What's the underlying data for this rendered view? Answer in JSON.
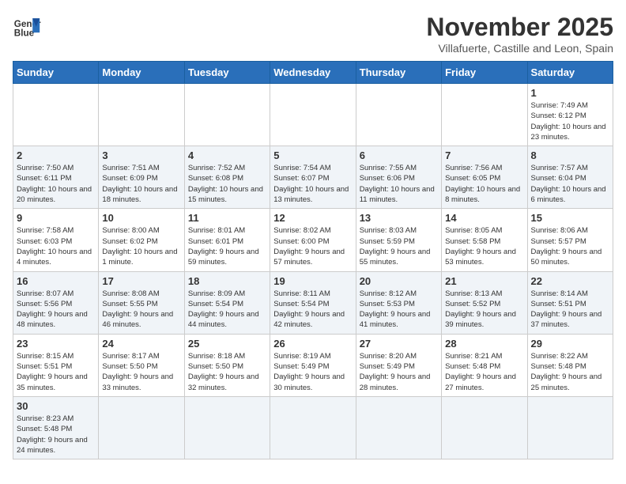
{
  "header": {
    "logo_line1": "General",
    "logo_line2": "Blue",
    "title": "November 2025",
    "subtitle": "Villafuerte, Castille and Leon, Spain"
  },
  "days_of_week": [
    "Sunday",
    "Monday",
    "Tuesday",
    "Wednesday",
    "Thursday",
    "Friday",
    "Saturday"
  ],
  "weeks": [
    [
      {
        "day": "",
        "info": ""
      },
      {
        "day": "",
        "info": ""
      },
      {
        "day": "",
        "info": ""
      },
      {
        "day": "",
        "info": ""
      },
      {
        "day": "",
        "info": ""
      },
      {
        "day": "",
        "info": ""
      },
      {
        "day": "1",
        "info": "Sunrise: 7:49 AM\nSunset: 6:12 PM\nDaylight: 10 hours and 23 minutes."
      }
    ],
    [
      {
        "day": "2",
        "info": "Sunrise: 7:50 AM\nSunset: 6:11 PM\nDaylight: 10 hours and 20 minutes."
      },
      {
        "day": "3",
        "info": "Sunrise: 7:51 AM\nSunset: 6:09 PM\nDaylight: 10 hours and 18 minutes."
      },
      {
        "day": "4",
        "info": "Sunrise: 7:52 AM\nSunset: 6:08 PM\nDaylight: 10 hours and 15 minutes."
      },
      {
        "day": "5",
        "info": "Sunrise: 7:54 AM\nSunset: 6:07 PM\nDaylight: 10 hours and 13 minutes."
      },
      {
        "day": "6",
        "info": "Sunrise: 7:55 AM\nSunset: 6:06 PM\nDaylight: 10 hours and 11 minutes."
      },
      {
        "day": "7",
        "info": "Sunrise: 7:56 AM\nSunset: 6:05 PM\nDaylight: 10 hours and 8 minutes."
      },
      {
        "day": "8",
        "info": "Sunrise: 7:57 AM\nSunset: 6:04 PM\nDaylight: 10 hours and 6 minutes."
      }
    ],
    [
      {
        "day": "9",
        "info": "Sunrise: 7:58 AM\nSunset: 6:03 PM\nDaylight: 10 hours and 4 minutes."
      },
      {
        "day": "10",
        "info": "Sunrise: 8:00 AM\nSunset: 6:02 PM\nDaylight: 10 hours and 1 minute."
      },
      {
        "day": "11",
        "info": "Sunrise: 8:01 AM\nSunset: 6:01 PM\nDaylight: 9 hours and 59 minutes."
      },
      {
        "day": "12",
        "info": "Sunrise: 8:02 AM\nSunset: 6:00 PM\nDaylight: 9 hours and 57 minutes."
      },
      {
        "day": "13",
        "info": "Sunrise: 8:03 AM\nSunset: 5:59 PM\nDaylight: 9 hours and 55 minutes."
      },
      {
        "day": "14",
        "info": "Sunrise: 8:05 AM\nSunset: 5:58 PM\nDaylight: 9 hours and 53 minutes."
      },
      {
        "day": "15",
        "info": "Sunrise: 8:06 AM\nSunset: 5:57 PM\nDaylight: 9 hours and 50 minutes."
      }
    ],
    [
      {
        "day": "16",
        "info": "Sunrise: 8:07 AM\nSunset: 5:56 PM\nDaylight: 9 hours and 48 minutes."
      },
      {
        "day": "17",
        "info": "Sunrise: 8:08 AM\nSunset: 5:55 PM\nDaylight: 9 hours and 46 minutes."
      },
      {
        "day": "18",
        "info": "Sunrise: 8:09 AM\nSunset: 5:54 PM\nDaylight: 9 hours and 44 minutes."
      },
      {
        "day": "19",
        "info": "Sunrise: 8:11 AM\nSunset: 5:54 PM\nDaylight: 9 hours and 42 minutes."
      },
      {
        "day": "20",
        "info": "Sunrise: 8:12 AM\nSunset: 5:53 PM\nDaylight: 9 hours and 41 minutes."
      },
      {
        "day": "21",
        "info": "Sunrise: 8:13 AM\nSunset: 5:52 PM\nDaylight: 9 hours and 39 minutes."
      },
      {
        "day": "22",
        "info": "Sunrise: 8:14 AM\nSunset: 5:51 PM\nDaylight: 9 hours and 37 minutes."
      }
    ],
    [
      {
        "day": "23",
        "info": "Sunrise: 8:15 AM\nSunset: 5:51 PM\nDaylight: 9 hours and 35 minutes."
      },
      {
        "day": "24",
        "info": "Sunrise: 8:17 AM\nSunset: 5:50 PM\nDaylight: 9 hours and 33 minutes."
      },
      {
        "day": "25",
        "info": "Sunrise: 8:18 AM\nSunset: 5:50 PM\nDaylight: 9 hours and 32 minutes."
      },
      {
        "day": "26",
        "info": "Sunrise: 8:19 AM\nSunset: 5:49 PM\nDaylight: 9 hours and 30 minutes."
      },
      {
        "day": "27",
        "info": "Sunrise: 8:20 AM\nSunset: 5:49 PM\nDaylight: 9 hours and 28 minutes."
      },
      {
        "day": "28",
        "info": "Sunrise: 8:21 AM\nSunset: 5:48 PM\nDaylight: 9 hours and 27 minutes."
      },
      {
        "day": "29",
        "info": "Sunrise: 8:22 AM\nSunset: 5:48 PM\nDaylight: 9 hours and 25 minutes."
      }
    ],
    [
      {
        "day": "30",
        "info": "Sunrise: 8:23 AM\nSunset: 5:48 PM\nDaylight: 9 hours and 24 minutes."
      },
      {
        "day": "",
        "info": ""
      },
      {
        "day": "",
        "info": ""
      },
      {
        "day": "",
        "info": ""
      },
      {
        "day": "",
        "info": ""
      },
      {
        "day": "",
        "info": ""
      },
      {
        "day": "",
        "info": ""
      }
    ]
  ]
}
